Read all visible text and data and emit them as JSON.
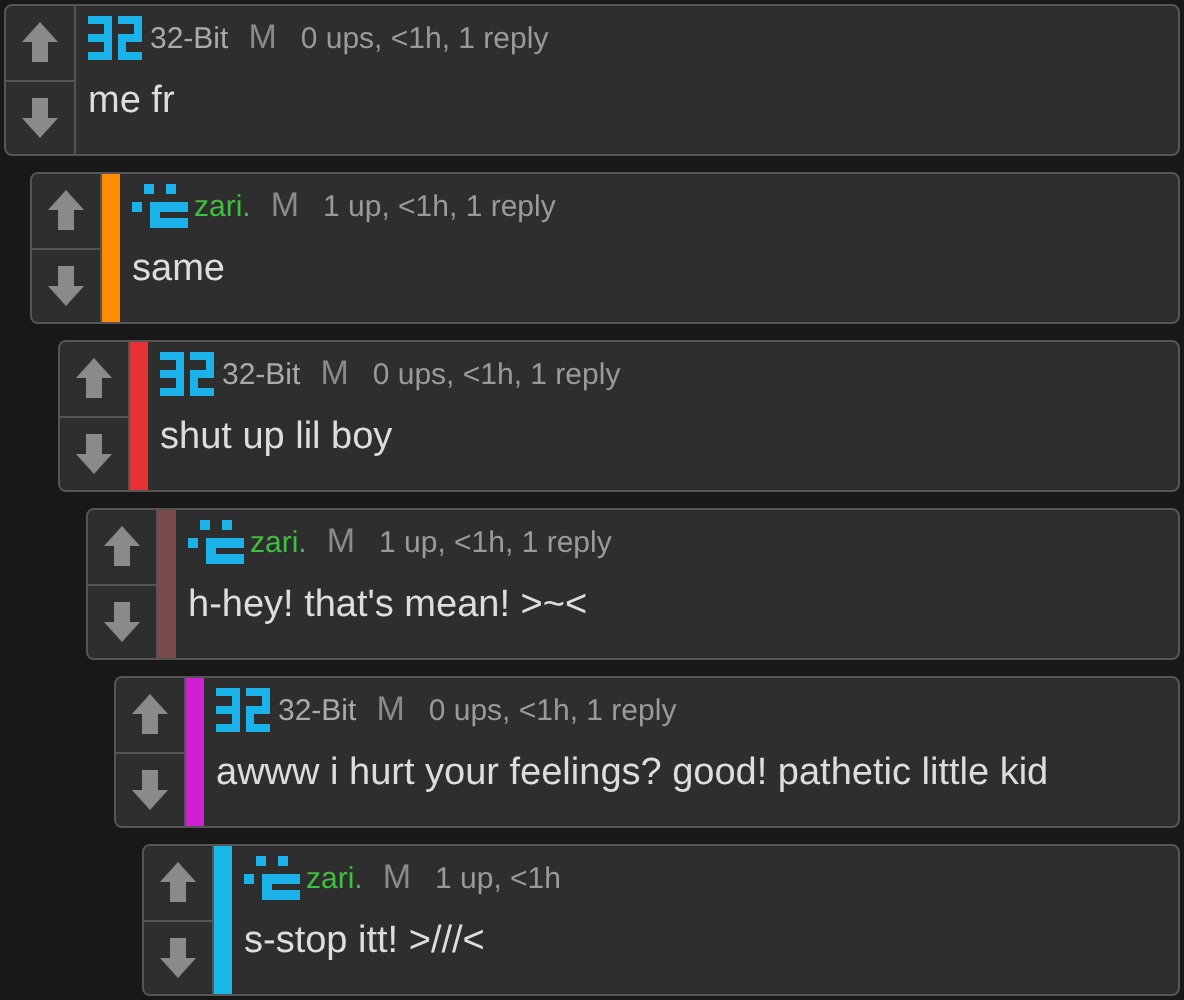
{
  "comments": [
    {
      "author": "32-Bit",
      "kind": "digits",
      "gender": "M",
      "meta": "0 ups, <1h, 1 reply",
      "text": "me fr",
      "children": [
        {
          "author": "zari.",
          "kind": "pixels",
          "color": "#ff8c00",
          "gender": "M",
          "meta": "1 up, <1h, 1 reply",
          "text": "same",
          "children": [
            {
              "author": "32-Bit",
              "kind": "digits",
              "color": "#e63232",
              "gender": "M",
              "meta": "0 ups, <1h, 1 reply",
              "text": "shut up lil boy",
              "children": [
                {
                  "author": "zari.",
                  "kind": "pixels",
                  "color": "#7a4a4a",
                  "gender": "M",
                  "meta": "1 up, <1h, 1 reply",
                  "text": "h-hey! that's mean! >~<",
                  "children": [
                    {
                      "author": "32-Bit",
                      "kind": "digits",
                      "color": "#d020d0",
                      "gender": "M",
                      "meta": "0 ups, <1h, 1 reply",
                      "text": "awww i hurt your feelings? good! pathetic little kid",
                      "children": [
                        {
                          "author": "zari.",
                          "kind": "pixels",
                          "color": "#1ab8e8",
                          "gender": "M",
                          "meta": "1 up, <1h",
                          "text": "s-stop itt! >///<"
                        }
                      ]
                    }
                  ]
                }
              ]
            }
          ]
        }
      ]
    }
  ]
}
